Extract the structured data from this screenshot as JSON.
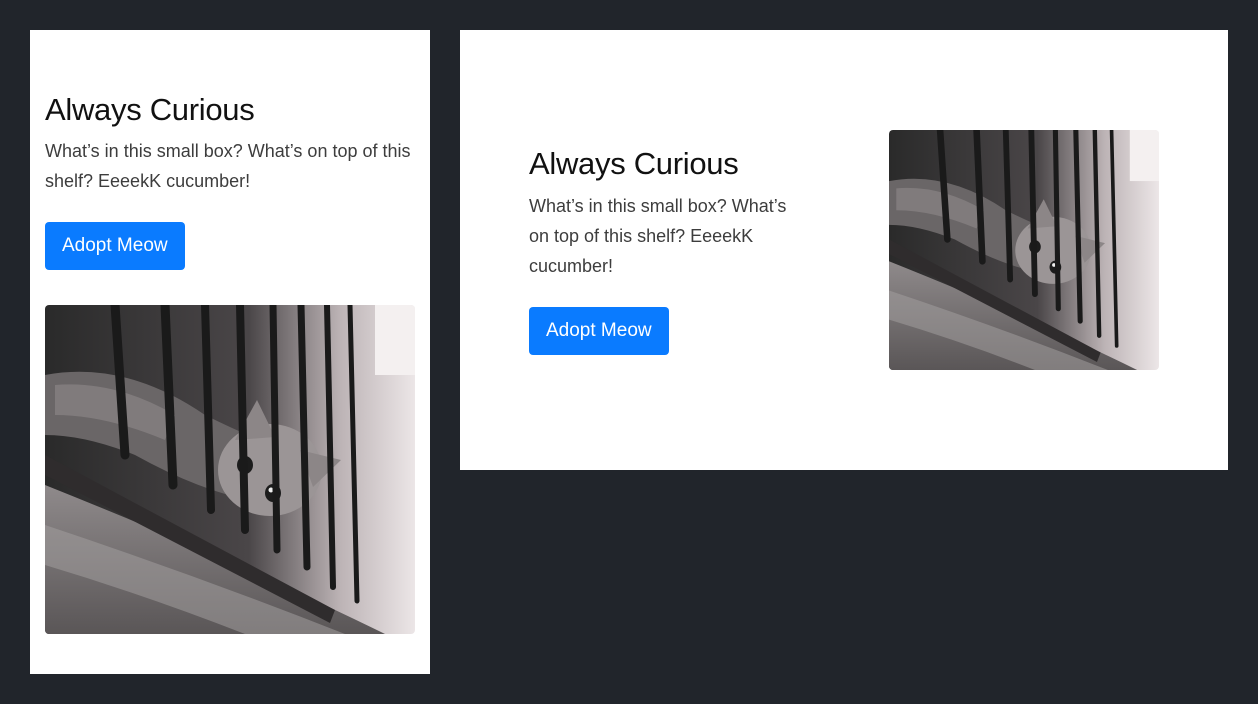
{
  "card": {
    "title": "Always Curious",
    "description": "What’s in this small box? What’s on top of this shelf? EeeekK cucumber!",
    "button_label": "Adopt Meow"
  },
  "colors": {
    "page_background": "#21252b",
    "panel_background": "#ffffff",
    "button": "#0a7bff",
    "button_text": "#ffffff"
  },
  "image": {
    "subject": "cat-looking-down-through-balcony-railing",
    "style": "black-and-white photo"
  }
}
